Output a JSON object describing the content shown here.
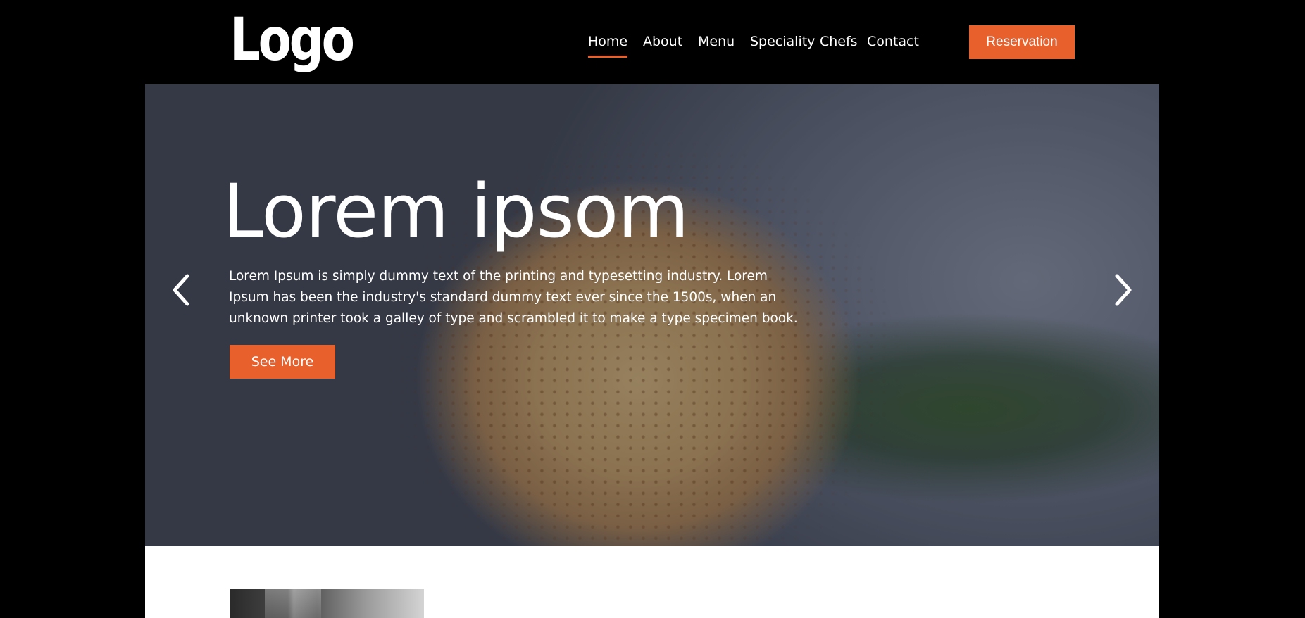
{
  "header": {
    "logo_text": "Logo",
    "nav": [
      {
        "label": "Home",
        "active": true
      },
      {
        "label": "About",
        "active": false
      },
      {
        "label": "Menu",
        "active": false
      },
      {
        "label": "Speciality",
        "active": false
      },
      {
        "label": "Chefs",
        "active": false
      },
      {
        "label": "Contact",
        "active": false
      }
    ],
    "reservation_label": "Reservation"
  },
  "hero": {
    "title": "Lorem ipsom",
    "text": "Lorem Ipsum is simply dummy text of the printing and typesetting industry. Lorem Ipsum has been the industry's standard dummy text ever since the 1500s, when an unknown printer took a galley of type and scrambled it to make a type specimen book.",
    "button_label": "See More",
    "prev_icon": "chevron-left-icon",
    "next_icon": "chevron-right-icon"
  },
  "colors": {
    "accent": "#e8602c",
    "background": "#000000",
    "text": "#ffffff"
  }
}
